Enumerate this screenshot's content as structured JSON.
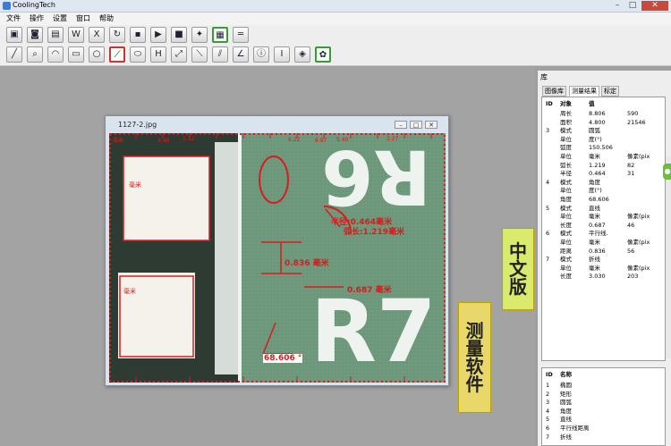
{
  "window": {
    "title": "CoolingTech",
    "min": "–",
    "max": "□",
    "close": "✕"
  },
  "menu": [
    "文件",
    "操作",
    "设置",
    "窗口",
    "帮助"
  ],
  "toolbar_row1": [
    "monitor-icon",
    "camera-icon",
    "open-folder-icon",
    "word-export-icon",
    "excel-export-icon",
    "refresh-icon",
    "save-icon",
    "play-icon",
    "stop-icon",
    "settings-icon",
    "grid-icon",
    "ruler-icon"
  ],
  "toolbar_row2": [
    "line-tool-icon",
    "magnify-tool-icon",
    "arc-tool-icon",
    "rectangle-tool-icon",
    "circle-tool-icon",
    "polyline-tool-icon",
    "ellipse-tool-icon",
    "h-tool-icon",
    "point-distance-icon",
    "line-distance-icon",
    "parallel-distance-icon",
    "angle-tool-icon",
    "info-icon",
    "text-tool-icon",
    "calibrate-icon",
    "palette-icon"
  ],
  "image_window": {
    "title": "1127-2.jpg",
    "labels": {
      "m_radius": "半径:0.464毫米",
      "m_arc": "弧长:1.219毫米",
      "m_dist": "0.836 毫米",
      "m_line": "0.687 毫米",
      "m_angle": "68.606 °",
      "m_mm1": "毫米",
      "m_mm2": "毫米"
    },
    "ruler_ticks": [
      "毫米",
      "4.48",
      "1.12",
      "6.22",
      "6.97",
      "5.49",
      "2.27"
    ]
  },
  "panel": {
    "title": "库",
    "tabs": [
      "图像库",
      "测量结果",
      "标定"
    ],
    "header": {
      "id": "ID",
      "obj": "对象",
      "val": "值"
    },
    "rows": [
      [
        "",
        "周长",
        "8.806",
        "590"
      ],
      [
        "",
        "面积",
        "4.800",
        "21546"
      ],
      [
        "3",
        "模式",
        "圆弧",
        ""
      ],
      [
        "",
        "单位",
        "度(°)",
        ""
      ],
      [
        "",
        "弧度",
        "150.506",
        ""
      ],
      [
        "",
        "单位",
        "毫米",
        "像素(pix"
      ],
      [
        "",
        "弧长",
        "1.219",
        "82"
      ],
      [
        "",
        "半径",
        "0.464",
        "31"
      ],
      [
        "4",
        "模式",
        "角度",
        ""
      ],
      [
        "",
        "单位",
        "度(°)",
        ""
      ],
      [
        "",
        "角度",
        "68.606",
        ""
      ],
      [
        "5",
        "模式",
        "直线",
        ""
      ],
      [
        "",
        "单位",
        "毫米",
        "像素(pix"
      ],
      [
        "",
        "长度",
        "0.687",
        "46"
      ],
      [
        "6",
        "模式",
        "平行线.",
        ""
      ],
      [
        "",
        "单位",
        "毫米",
        "像素(pix"
      ],
      [
        "",
        "距离",
        "0.836",
        "56"
      ],
      [
        "7",
        "模式",
        "折线",
        ""
      ],
      [
        "",
        "单位",
        "毫米",
        "像素(pix"
      ],
      [
        "",
        "长度",
        "3.030",
        "203"
      ]
    ],
    "list_header": {
      "id": "ID",
      "name": "名称"
    },
    "list": [
      [
        "1",
        "椭圆"
      ],
      [
        "2",
        "矩形"
      ],
      [
        "3",
        "圆弧"
      ],
      [
        "4",
        "角度"
      ],
      [
        "5",
        "直线"
      ],
      [
        "6",
        "平行线距离"
      ],
      [
        "7",
        "折线"
      ]
    ]
  },
  "badges": {
    "chinese_version": [
      "中",
      "文",
      "版"
    ],
    "measure_software": [
      "测",
      "量",
      "软",
      "件"
    ]
  }
}
